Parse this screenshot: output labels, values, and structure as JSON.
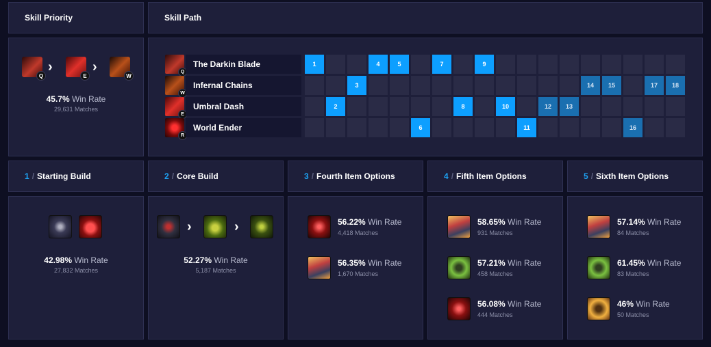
{
  "skill_priority": {
    "title": "Skill Priority",
    "keys": [
      "Q",
      "E",
      "W"
    ],
    "win_rate": "45.7%",
    "win_rate_label": "Win Rate",
    "matches": "29,631 Matches"
  },
  "skill_path": {
    "title": "Skill Path",
    "rows": [
      {
        "key": "Q",
        "name": "The Darkin Blade",
        "levels": [
          1,
          4,
          5,
          7,
          9
        ]
      },
      {
        "key": "W",
        "name": "Infernal Chains",
        "levels": [
          3,
          14,
          15,
          17,
          18
        ]
      },
      {
        "key": "E",
        "name": "Umbral Dash",
        "levels": [
          2,
          8,
          10,
          12,
          13
        ]
      },
      {
        "key": "R",
        "name": "World Ender",
        "levels": [
          6,
          11,
          16
        ]
      }
    ]
  },
  "builds": [
    {
      "num": "1",
      "sep": "/",
      "title": "Starting Build",
      "win_rate": "42.98%",
      "win_rate_label": "Win Rate",
      "matches": "27,832 Matches"
    },
    {
      "num": "2",
      "sep": "/",
      "title": "Core Build",
      "win_rate": "52.27%",
      "win_rate_label": "Win Rate",
      "matches": "5,187 Matches"
    }
  ],
  "options": [
    {
      "num": "3",
      "sep": "/",
      "title": "Fourth Item Options",
      "items": [
        {
          "win_rate": "56.22%",
          "win_rate_label": "Win Rate",
          "matches": "4,418 Matches"
        },
        {
          "win_rate": "56.35%",
          "win_rate_label": "Win Rate",
          "matches": "1,670 Matches"
        }
      ]
    },
    {
      "num": "4",
      "sep": "/",
      "title": "Fifth Item Options",
      "items": [
        {
          "win_rate": "58.65%",
          "win_rate_label": "Win Rate",
          "matches": "931 Matches"
        },
        {
          "win_rate": "57.21%",
          "win_rate_label": "Win Rate",
          "matches": "458 Matches"
        },
        {
          "win_rate": "56.08%",
          "win_rate_label": "Win Rate",
          "matches": "444 Matches"
        }
      ]
    },
    {
      "num": "5",
      "sep": "/",
      "title": "Sixth Item Options",
      "items": [
        {
          "win_rate": "57.14%",
          "win_rate_label": "Win Rate",
          "matches": "84 Matches"
        },
        {
          "win_rate": "61.45%",
          "win_rate_label": "Win Rate",
          "matches": "83 Matches"
        },
        {
          "win_rate": "46%",
          "win_rate_label": "Win Rate",
          "matches": "50 Matches"
        }
      ]
    }
  ],
  "colors": {
    "accent": "#0d9fff",
    "panel": "#1e1f3a",
    "background": "#0e0f22"
  }
}
